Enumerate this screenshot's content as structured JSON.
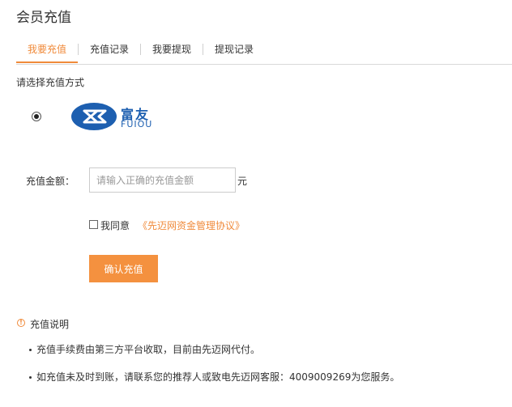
{
  "page": {
    "title": "会员充值"
  },
  "tabs": [
    {
      "label": "我要充值",
      "active": true
    },
    {
      "label": "充值记录",
      "active": false
    },
    {
      "label": "我要提现",
      "active": false
    },
    {
      "label": "提现记录",
      "active": false
    }
  ],
  "method": {
    "label": "请选择充值方式",
    "selected": true,
    "provider": {
      "cn": "富友",
      "en": "FUIOU",
      "icon": "fuiou-logo-icon",
      "color": "#1d5fb0"
    }
  },
  "amount": {
    "label": "充值金额：",
    "placeholder": "请输入正确的充值金额",
    "value": "",
    "unit": "元"
  },
  "agreement": {
    "checked": false,
    "text": "我同意",
    "link": "《先迈网资金管理协议》"
  },
  "confirm_label": "确认充值",
  "notes": {
    "title": "充值说明",
    "items": [
      "充值手续费由第三方平台收取，目前由先迈网代付。",
      "如充值未及时到账，请联系您的推荐人或致电先迈网客服：4009009269为您服务。"
    ]
  },
  "colors": {
    "accent": "#f08a3a",
    "button": "#f4913f",
    "brand": "#1d5fb0"
  }
}
